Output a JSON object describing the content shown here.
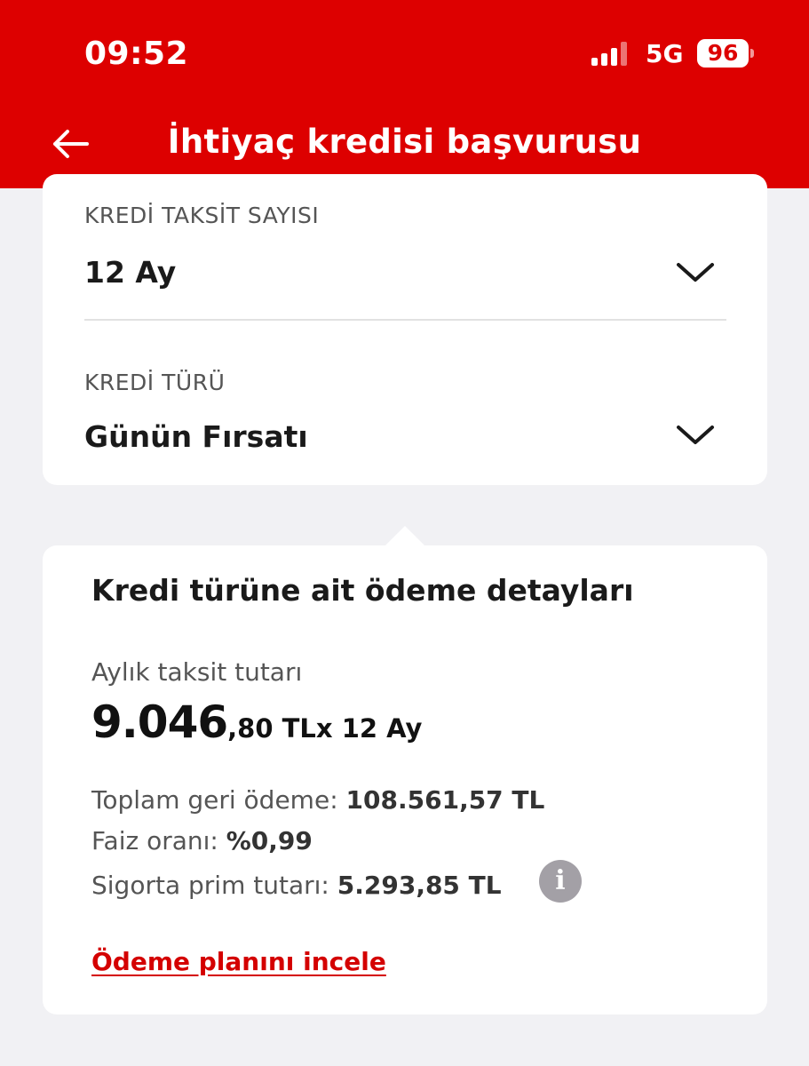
{
  "status_bar": {
    "time": "09:52",
    "network": "5G",
    "battery": "96"
  },
  "header": {
    "title": "İhtiyaç kredisi başvurusu",
    "back_icon": "arrow-left-icon",
    "color": "#dd0000"
  },
  "form": {
    "installment_label": "KREDİ TAKSİT SAYISI",
    "installment_value": "12 Ay",
    "credit_type_label": "KREDİ TÜRÜ",
    "credit_type_value": "Günün Fırsatı",
    "dropdown_icon": "chevron-down-icon"
  },
  "details": {
    "title": "Kredi türüne ait ödeme detayları",
    "monthly_label": "Aylık taksit tutarı",
    "monthly_amount_int": "9.046",
    "monthly_amount_dec": ",80 TL",
    "monthly_amount_suffix": "x 12 Ay",
    "total_label": "Toplam geri ödeme:",
    "total_value": "108.561,57 TL",
    "rate_label": "Faiz oranı:",
    "rate_value": "%0,99",
    "insurance_label": "Sigorta prim tutarı:",
    "insurance_value": "5.293,85 TL",
    "info_icon": "info-icon",
    "info_glyph": "i",
    "plan_link": "Ödeme planını incele",
    "link_color": "#d40000"
  }
}
